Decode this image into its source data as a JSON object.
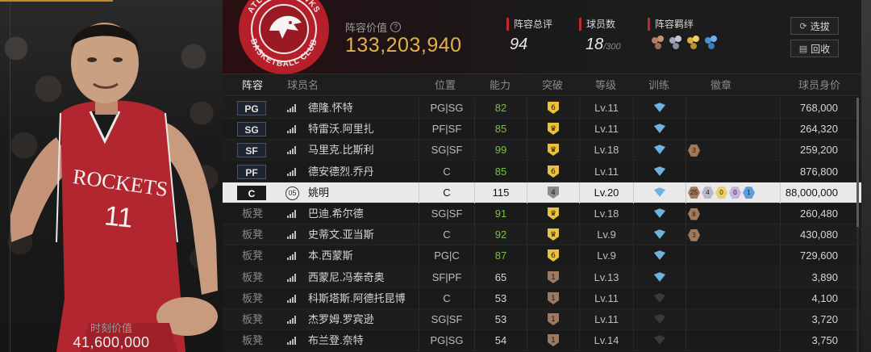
{
  "player_card": {
    "value_label": "时刻价值",
    "value": "41,600,000",
    "jersey_team": "ROCKETS",
    "jersey_number": "11"
  },
  "header": {
    "lineup_value_label": "阵容价值",
    "lineup_value": "133,203,940",
    "rating_label": "阵容总评",
    "rating": "94",
    "players_label": "球员数",
    "players_count": "18",
    "players_max": "/300",
    "chemistry_label": "阵容羁绊",
    "chemistry_icons": [
      "chemistry-bronze-icon",
      "chemistry-silver-icon",
      "chemistry-gold-icon",
      "chemistry-blue-icon"
    ],
    "select_button": "选拔",
    "recycle_button": "回收",
    "team_logo_text_top": "ATLANTA HAWKS",
    "team_logo_text_bottom": "BASKETBALL CLUB"
  },
  "table": {
    "columns": {
      "lineup": "阵容",
      "name": "球员名",
      "position": "位置",
      "ability": "能力",
      "breakthrough": "突破",
      "level": "等级",
      "training": "训练",
      "badges": "徽章",
      "price": "球员身价"
    },
    "rows": [
      {
        "slot": "PG",
        "name": "德隆.怀特",
        "position": "PG|SG",
        "ability": "82",
        "break": "6",
        "break_color": "#e8c23a",
        "level": "Lv.11",
        "price": "768,000",
        "badges": []
      },
      {
        "slot": "SG",
        "name": "特雷沃.阿里扎",
        "position": "PF|SF",
        "ability": "85",
        "break": "♛",
        "break_color": "#e8c23a",
        "level": "Lv.11",
        "price": "264,320",
        "badges": []
      },
      {
        "slot": "SF",
        "name": "马里克.比斯利",
        "position": "SG|SF",
        "ability": "99",
        "break": "♛",
        "break_color": "#e8c23a",
        "level": "Lv.18",
        "price": "259,200",
        "badges": [
          {
            "n": "3",
            "c": "#a07a5a"
          }
        ]
      },
      {
        "slot": "PF",
        "name": "德安德烈.乔丹",
        "position": "C",
        "ability": "85",
        "break": "6",
        "break_color": "#e8c23a",
        "level": "Lv.11",
        "price": "876,800",
        "badges": []
      },
      {
        "slot": "C",
        "name": "姚明",
        "jersey": "05",
        "position": "C",
        "ability": "115",
        "break": "4",
        "break_color": "#8a8a8a",
        "level": "Lv.20",
        "price": "88,000,000",
        "badges": [
          {
            "n": "25",
            "c": "#a07a5a"
          },
          {
            "n": "4",
            "c": "#b8b8c8"
          },
          {
            "n": "0",
            "c": "#e8d070"
          },
          {
            "n": "0",
            "c": "#c8b0e0"
          },
          {
            "n": "1",
            "c": "#5aa0e0"
          }
        ]
      },
      {
        "slot": "板凳",
        "name": "巴迪.希尔德",
        "position": "SG|SF",
        "ability": "91",
        "break": "♛",
        "break_color": "#e8c23a",
        "level": "Lv.18",
        "price": "260,480",
        "badges": [
          {
            "n": "8",
            "c": "#a07a5a"
          }
        ]
      },
      {
        "slot": "板凳",
        "name": "史蒂文.亚当斯",
        "position": "C",
        "ability": "92",
        "break": "♛",
        "break_color": "#e8c23a",
        "level": "Lv.9",
        "price": "430,080",
        "badges": [
          {
            "n": "3",
            "c": "#a07a5a"
          }
        ]
      },
      {
        "slot": "板凳",
        "name": "本.西蒙斯",
        "position": "PG|C",
        "ability": "87",
        "break": "6",
        "break_color": "#e8c23a",
        "level": "Lv.9",
        "price": "729,600",
        "badges": []
      },
      {
        "slot": "板凳",
        "name": "西蒙尼.冯泰奇奥",
        "position": "SF|PF",
        "ability": "65",
        "break": "1",
        "break_color": "#9a7a62",
        "level": "Lv.13",
        "price": "3,890",
        "badges": []
      },
      {
        "slot": "板凳",
        "name": "科斯塔斯.阿德托昆博",
        "position": "C",
        "ability": "53",
        "break": "1",
        "break_color": "#9a7a62",
        "level": "Lv.11",
        "price": "4,100",
        "badges": []
      },
      {
        "slot": "板凳",
        "name": "杰罗姆.罗宾逊",
        "position": "SG|SF",
        "ability": "53",
        "break": "1",
        "break_color": "#9a7a62",
        "level": "Lv.11",
        "price": "3,720",
        "badges": []
      },
      {
        "slot": "板凳",
        "name": "布兰登.奈特",
        "position": "PG|SG",
        "ability": "54",
        "break": "1",
        "break_color": "#9a7a62",
        "level": "Lv.14",
        "price": "3,750",
        "badges": []
      }
    ]
  },
  "colors": {
    "accent_gold": "#e3b04b",
    "accent_red": "#c0282e",
    "ability_green": "#7bc143",
    "training_blue": "#6fb2e0"
  }
}
